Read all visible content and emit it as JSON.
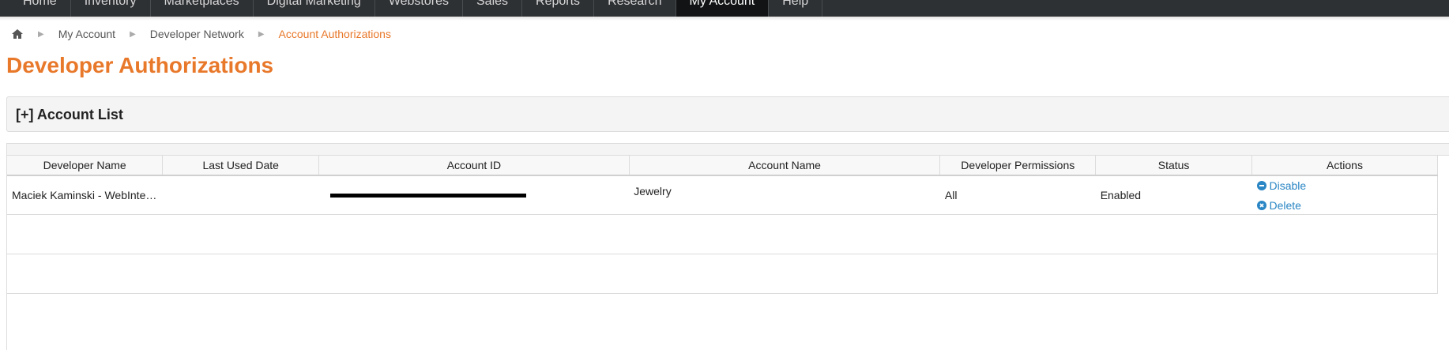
{
  "nav": {
    "items": [
      "Home",
      "Inventory",
      "Marketplaces",
      "Digital Marketing",
      "Webstores",
      "Sales",
      "Reports",
      "Research",
      "My Account",
      "Help"
    ],
    "active": "My Account"
  },
  "breadcrumb": {
    "items": [
      "My Account",
      "Developer Network",
      "Account Authorizations"
    ]
  },
  "page": {
    "title": "Developer Authorizations"
  },
  "account_list": {
    "title": "[+] Account List"
  },
  "table": {
    "headers": [
      "Developer Name",
      "Last Used Date",
      "Account ID",
      "Account Name",
      "Developer Permissions",
      "Status",
      "Actions"
    ],
    "rows": [
      {
        "developer_name": "Maciek Kaminski - WebInte…",
        "last_used_date": "",
        "account_id": "",
        "account_name": "Jewelry",
        "developer_permissions": "All",
        "status": "Enabled",
        "actions": [
          "Disable",
          "Delete"
        ]
      }
    ]
  },
  "colors": {
    "accent": "#e8782a",
    "link": "#2a86c4",
    "nav_bg": "#2e3134"
  }
}
